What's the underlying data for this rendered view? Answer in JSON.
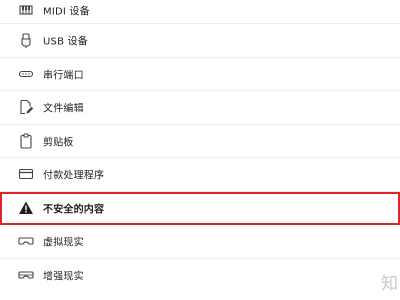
{
  "settings_list": {
    "items": [
      {
        "label": "MIDI 设备",
        "icon": "piano-icon"
      },
      {
        "label": "USB 设备",
        "icon": "usb-icon"
      },
      {
        "label": "串行端口",
        "icon": "serial-port-icon"
      },
      {
        "label": "文件编辑",
        "icon": "file-edit-icon"
      },
      {
        "label": "剪贴板",
        "icon": "clipboard-icon"
      },
      {
        "label": "付款处理程序",
        "icon": "card-icon"
      },
      {
        "label": "不安全的内容",
        "icon": "warning-icon"
      },
      {
        "label": "虚拟现实",
        "icon": "vr-headset-icon"
      },
      {
        "label": "增强现实",
        "icon": "ar-headset-icon"
      }
    ],
    "highlighted_index": 6,
    "highlight_color": "#e0252a"
  },
  "watermark": {
    "text": "知"
  }
}
